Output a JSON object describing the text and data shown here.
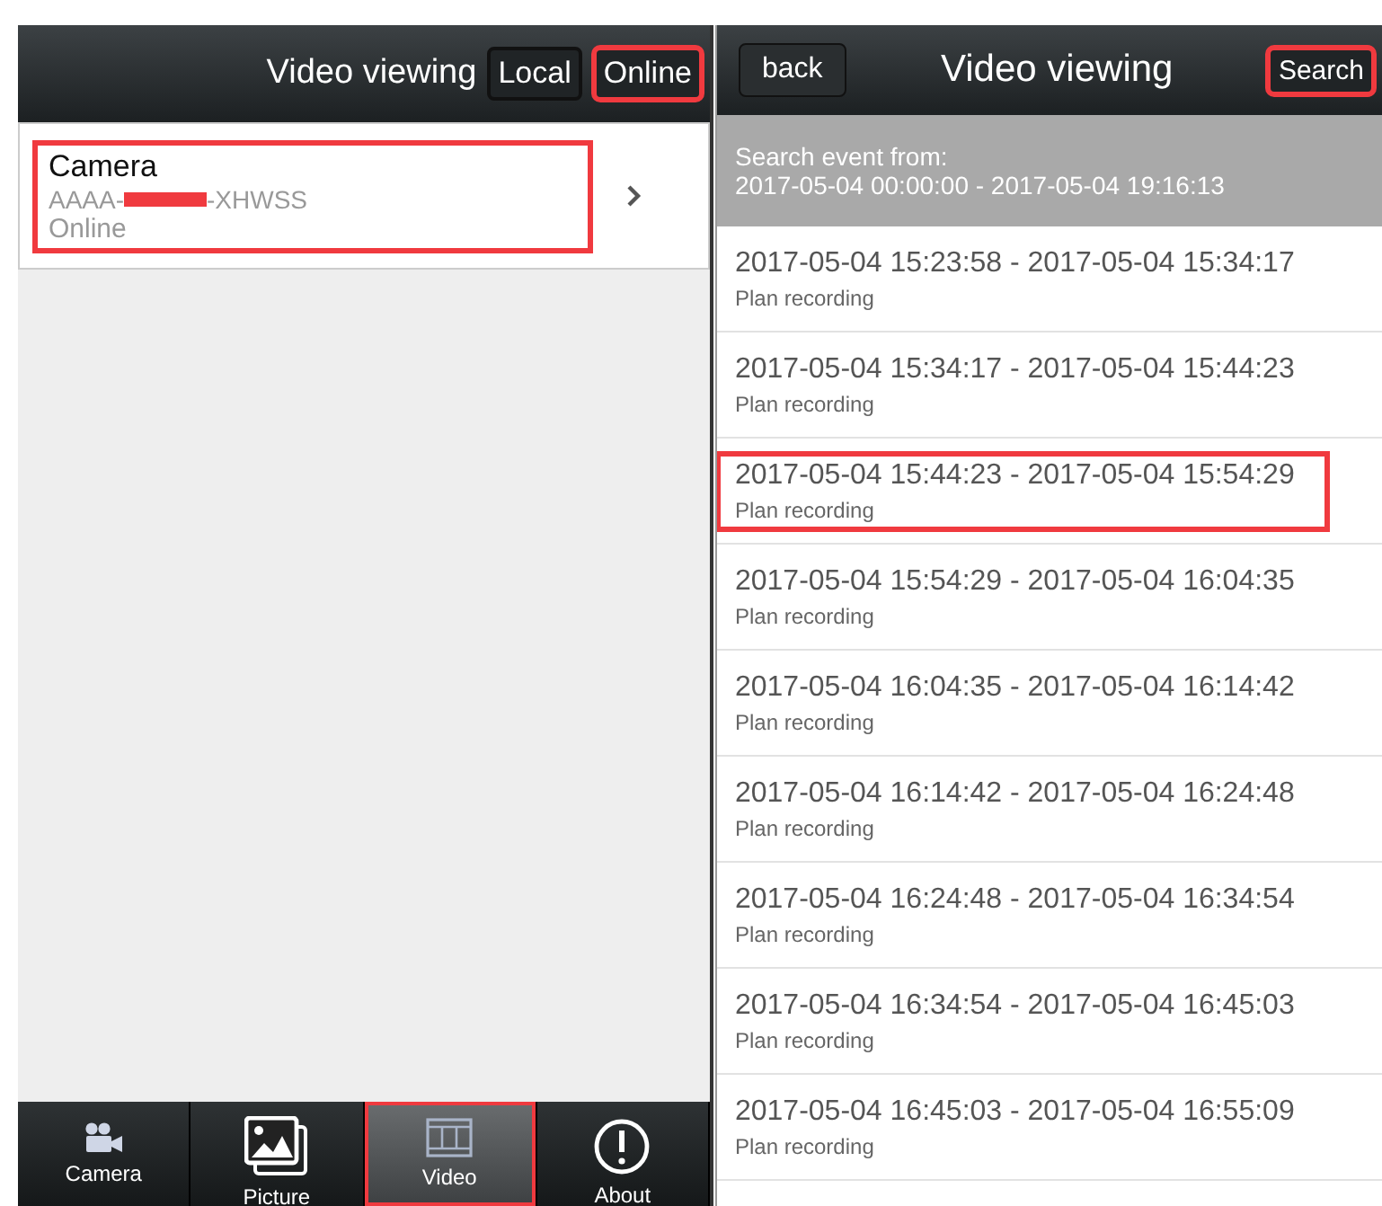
{
  "left_screen": {
    "title": "Video viewing",
    "header_buttons": [
      {
        "label": "Local",
        "highlighted": false
      },
      {
        "label": "Online",
        "highlighted": true
      }
    ],
    "camera": {
      "name": "Camera",
      "serial_prefix": "AAAA-",
      "serial_suffix": "-XHWSS",
      "status": "Online",
      "highlighted": true
    },
    "tabs": [
      {
        "label": "Camera",
        "kind": "camera",
        "selected": false,
        "highlighted": false
      },
      {
        "label": "Picture",
        "kind": "picture",
        "selected": false,
        "highlighted": false
      },
      {
        "label": "Video",
        "kind": "video",
        "selected": true,
        "highlighted": true
      },
      {
        "label": "About",
        "kind": "about",
        "selected": false,
        "highlighted": false
      }
    ]
  },
  "right_screen": {
    "back": "back",
    "title": "Video viewing",
    "search": {
      "label": "Search",
      "highlighted": true
    },
    "search_info": {
      "label": "Search event from:",
      "range": "2017-05-04 00:00:00 - 2017-05-04 19:16:13"
    },
    "recordings": [
      {
        "time": "2017-05-04 15:23:58 - 2017-05-04 15:34:17",
        "type": "Plan recording",
        "highlighted": false
      },
      {
        "time": "2017-05-04 15:34:17 - 2017-05-04 15:44:23",
        "type": "Plan recording",
        "highlighted": false
      },
      {
        "time": "2017-05-04 15:44:23 - 2017-05-04 15:54:29",
        "type": "Plan recording",
        "highlighted": true
      },
      {
        "time": "2017-05-04 15:54:29 - 2017-05-04 16:04:35",
        "type": "Plan recording",
        "highlighted": false
      },
      {
        "time": "2017-05-04 16:04:35 - 2017-05-04 16:14:42",
        "type": "Plan recording",
        "highlighted": false
      },
      {
        "time": "2017-05-04 16:14:42 - 2017-05-04 16:24:48",
        "type": "Plan recording",
        "highlighted": false
      },
      {
        "time": "2017-05-04 16:24:48 - 2017-05-04 16:34:54",
        "type": "Plan recording",
        "highlighted": false
      },
      {
        "time": "2017-05-04 16:34:54 - 2017-05-04 16:45:03",
        "type": "Plan recording",
        "highlighted": false
      },
      {
        "time": "2017-05-04 16:45:03 - 2017-05-04 16:55:09",
        "type": "Plan recording",
        "highlighted": false
      }
    ]
  }
}
